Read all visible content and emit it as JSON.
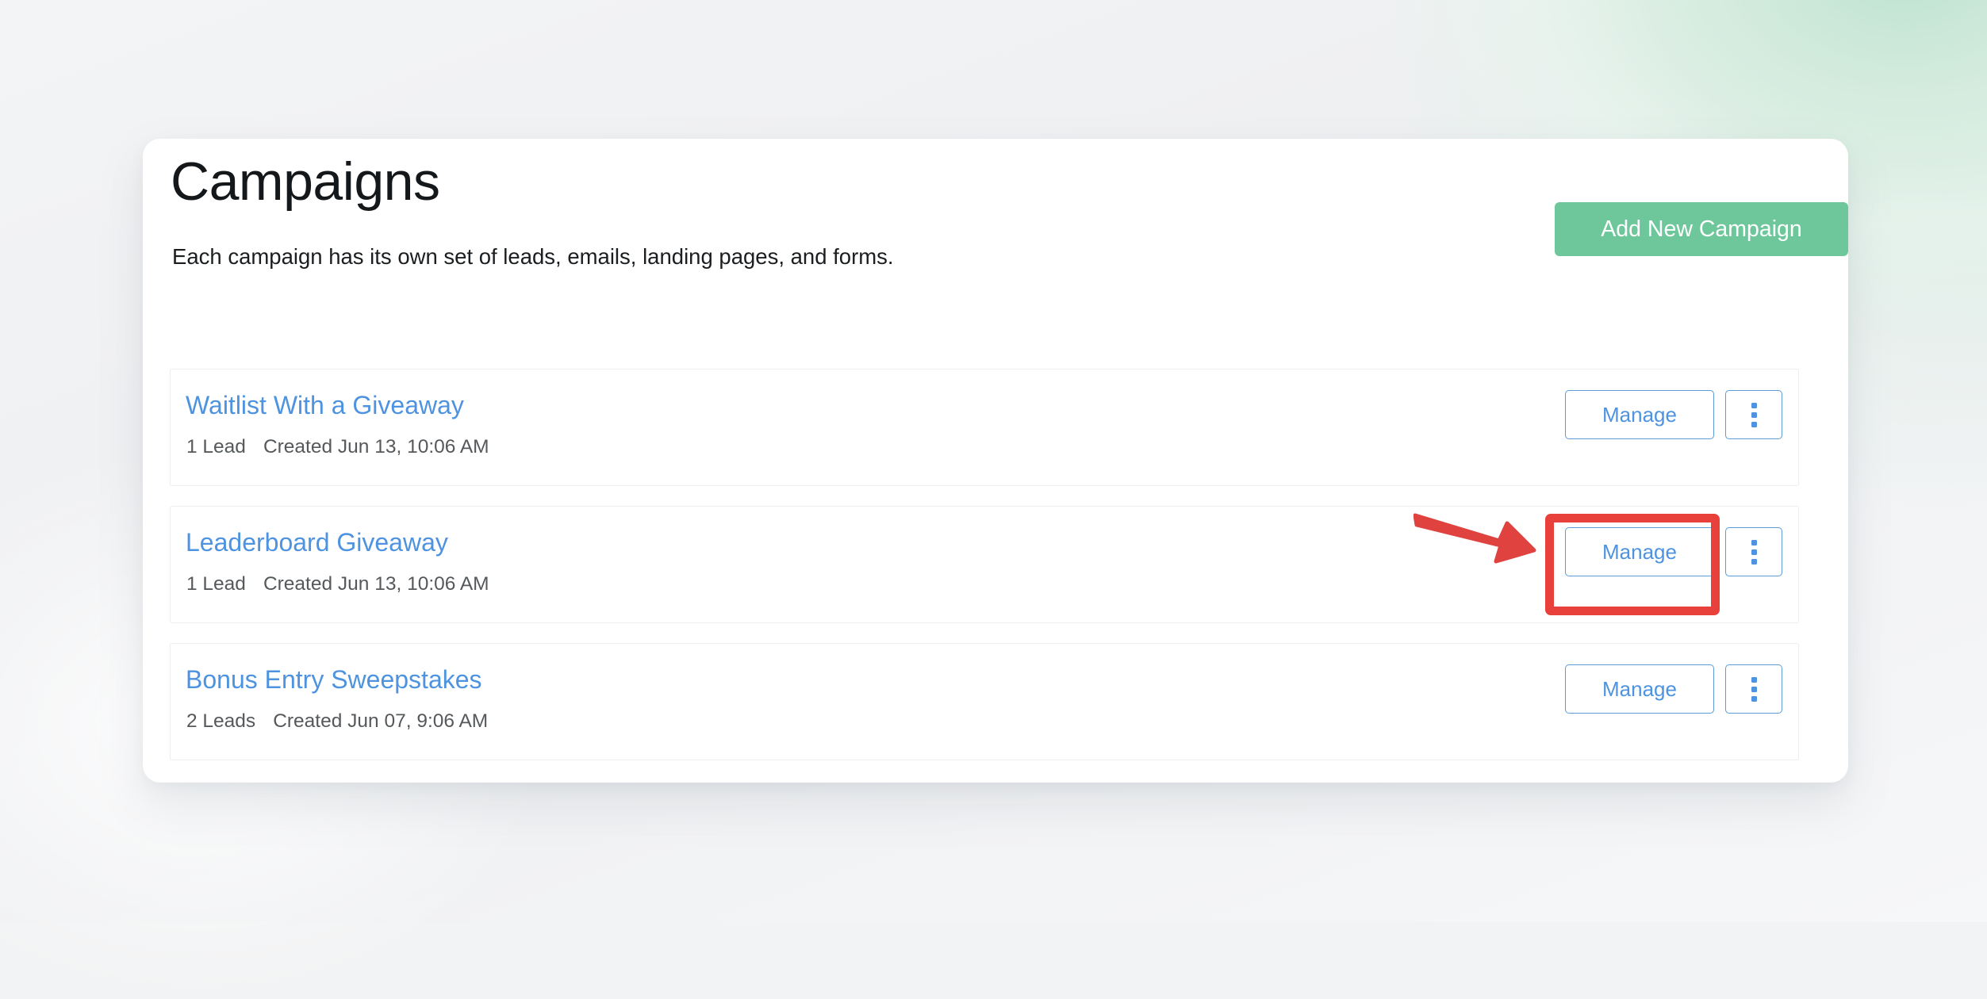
{
  "header": {
    "title": "Campaigns",
    "subtitle": "Each campaign has its own set of leads, emails, landing pages, and forms.",
    "add_button_label": "Add New Campaign"
  },
  "list": {
    "manage_label": "Manage",
    "kebab_icon": "kebab-menu-icon",
    "rows": [
      {
        "name": "Waitlist With a Giveaway",
        "leads": "1 Lead",
        "created": "Created Jun 13, 10:06 AM",
        "manage_label": "Manage"
      },
      {
        "name": "Leaderboard Giveaway",
        "leads": "1 Lead",
        "created": "Created Jun 13, 10:06 AM",
        "manage_label": "Manage"
      },
      {
        "name": "Bonus Entry Sweepstakes",
        "leads": "2 Leads",
        "created": "Created Jun 07, 9:06 AM",
        "manage_label": "Manage"
      }
    ]
  },
  "annotation": {
    "highlight_target": "Manage",
    "highlight_color": "#e8413c",
    "arrow_color": "#e0423f",
    "arrow_icon": "arrow-right-icon"
  },
  "colors": {
    "accent_green": "#6ec79b",
    "link_blue": "#4d93e0",
    "border_blue": "#5b9bd9",
    "card_white": "#ffffff",
    "row_border": "#ebedef",
    "meta_gray": "#55595c",
    "title_black": "#15181a"
  }
}
